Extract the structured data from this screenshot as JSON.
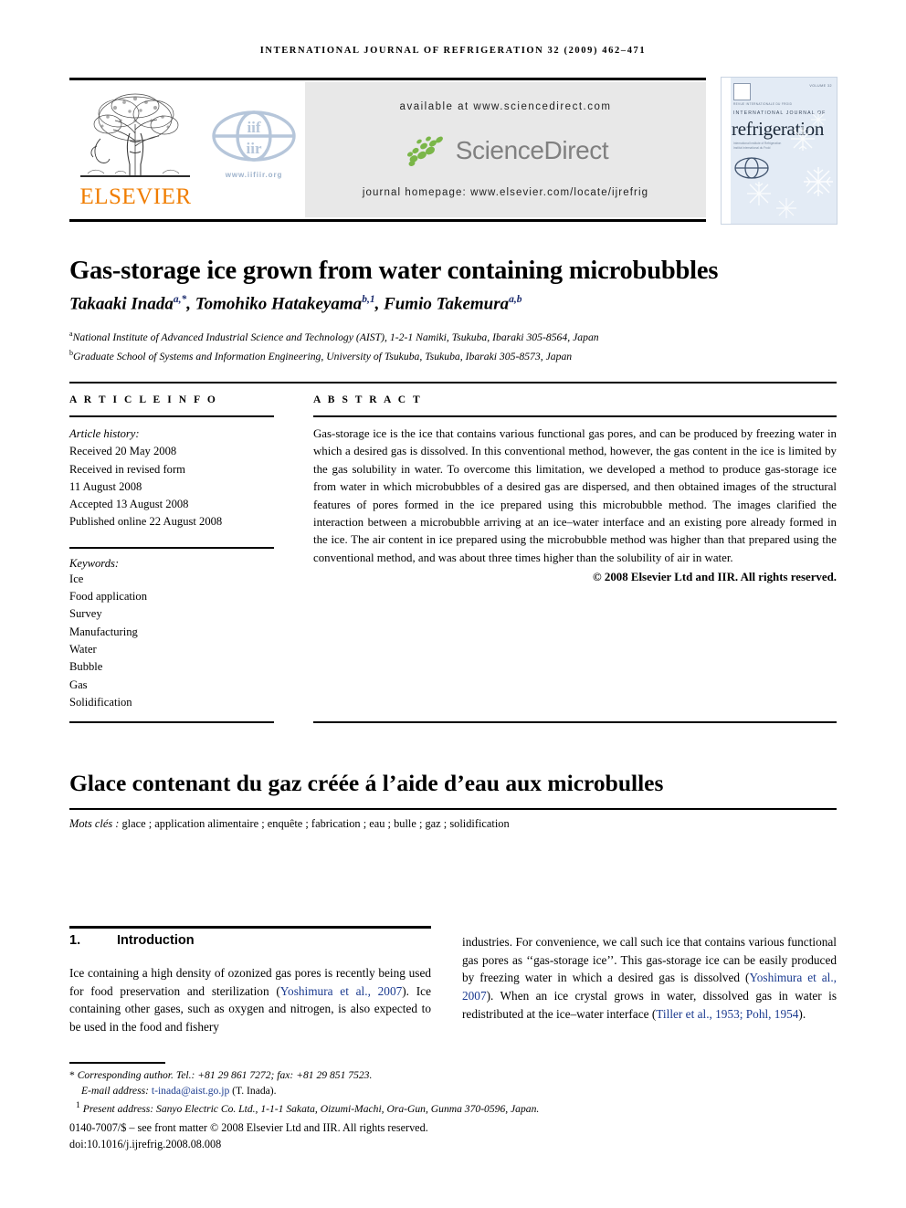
{
  "running_head": "International Journal of Refrigeration 32 (2009) 462–471",
  "header": {
    "publisher": "ELSEVIER",
    "iif_url": "www.iifiir.org",
    "iif_logo_top": "iif",
    "iif_logo_bottom": "iir",
    "available_at": "available at www.sciencedirect.com",
    "sciencedirect_word": "ScienceDirect",
    "journal_homepage": "journal homepage: www.elsevier.com/locate/ijrefrig",
    "accent_orange": "#F07D00",
    "sd_green": "#7AB648",
    "sd_gray": "#808080",
    "iif_blue": "#9FB3CC"
  },
  "cover": {
    "volume_label": "VOLUME 32",
    "tiny_line_top": "REVUE INTERNATIONALE DU FROID",
    "ij_line": "INTERNATIONAL JOURNAL OF",
    "refrigeration": "refrigeration",
    "tiny_line_sub1": "International Institute of Refrigeration",
    "tiny_line_sub2": "Institut International du Froid",
    "bg_color": "#E3EBF5"
  },
  "article": {
    "title": "Gas-storage ice grown from water containing microbubbles",
    "authors": [
      {
        "name": "Takaaki Inada",
        "marks": "a,*"
      },
      {
        "name": "Tomohiko Hatakeyama",
        "marks": "b,1"
      },
      {
        "name": "Fumio Takemura",
        "marks": "a,b"
      }
    ],
    "affiliations": [
      {
        "mark": "a",
        "text": "National Institute of Advanced Industrial Science and Technology (AIST), 1-2-1 Namiki, Tsukuba, Ibaraki 305-8564, Japan"
      },
      {
        "mark": "b",
        "text": "Graduate School of Systems and Information Engineering, University of Tsukuba, Tsukuba, Ibaraki 305-8573, Japan"
      }
    ]
  },
  "info": {
    "heading": "A R T I C L E   I N F O",
    "history_label": "Article history:",
    "history": [
      "Received 20 May 2008",
      "Received in revised form",
      "11 August 2008",
      "Accepted 13 August 2008",
      "Published online 22 August 2008"
    ],
    "keywords_label": "Keywords:",
    "keywords": [
      "Ice",
      "Food application",
      "Survey",
      "Manufacturing",
      "Water",
      "Bubble",
      "Gas",
      "Solidification"
    ]
  },
  "abstract": {
    "heading": "A B S T R A C T",
    "text": "Gas-storage ice is the ice that contains various functional gas pores, and can be produced by freezing water in which a desired gas is dissolved. In this conventional method, however, the gas content in the ice is limited by the gas solubility in water. To overcome this limitation, we developed a method to produce gas-storage ice from water in which microbubbles of a desired gas are dispersed, and then obtained images of the structural features of pores formed in the ice prepared using this microbubble method. The images clarified the interaction between a microbubble arriving at an ice–water interface and an existing pore already formed in the ice. The air content in ice prepared using the microbubble method was higher than that prepared using the conventional method, and was about three times higher than the solubility of air in water.",
    "copyright": "© 2008 Elsevier Ltd and IIR. All rights reserved."
  },
  "french": {
    "title": "Glace contenant du gaz créée á l’aide d’eau aux microbulles",
    "keywords_label": "Mots clés :",
    "keywords": "glace ; application alimentaire ; enquête ; fabrication ; eau ; bulle ; gaz ; solidification"
  },
  "body": {
    "section_number": "1.",
    "section_title": "Introduction",
    "left_paragraph_pre": "Ice containing a high density of ozonized gas pores is recently being used for food preservation and sterilization (",
    "left_cite_1": "Yoshimura et al., 2007",
    "left_paragraph_post": "). Ice containing other gases, such as oxygen and nitrogen, is also expected to be used in the food and fishery",
    "right_part_1": "industries. For convenience, we call such ice that contains various functional gas pores as ‘‘gas-storage ice’’. This gas-storage ice can be easily produced by freezing water in which a desired gas is dissolved (",
    "right_cite_1": "Yoshimura et al., 2007",
    "right_part_2": "). When an ice crystal grows in water, dissolved gas in water is redistributed at the ice–water interface (",
    "right_cite_2": "Tiller et al., 1953; Pohl, 1954",
    "right_part_3": ")."
  },
  "footnotes": {
    "corresponding_mark": "*",
    "corresponding_text": "Corresponding author. Tel.: +81 29 861 7272; fax: +81 29 851 7523.",
    "email_label": "E-mail address:",
    "email": "t-inada@aist.go.jp",
    "email_suffix": "(T. Inada).",
    "present_mark": "1",
    "present_address": "Present address: Sanyo Electric Co. Ltd., 1-1-1 Sakata, Oizumi-Machi, Ora-Gun, Gunma 370-0596, Japan.",
    "issn_line": "0140-7007/$ – see front matter © 2008 Elsevier Ltd and IIR. All rights reserved.",
    "doi_line": "doi:10.1016/j.ijrefrig.2008.08.008"
  }
}
